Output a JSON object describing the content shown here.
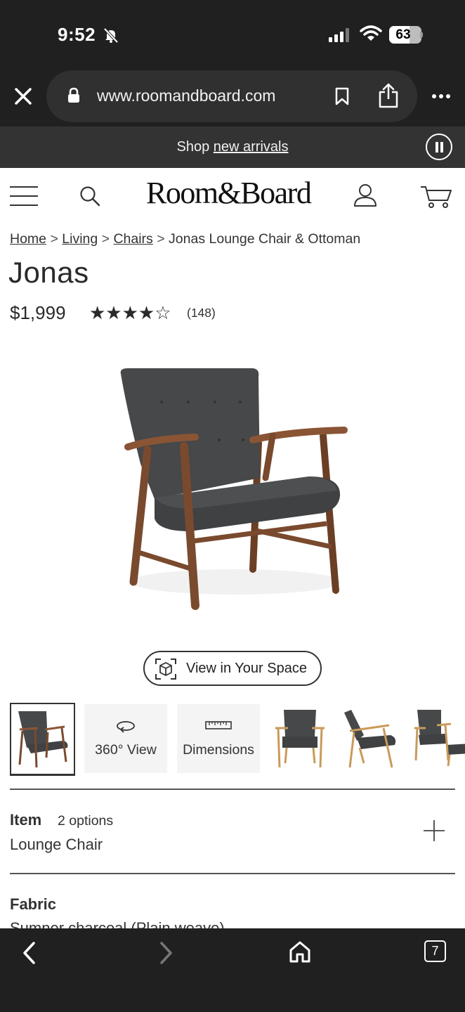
{
  "status_bar": {
    "time": "9:52",
    "battery": "63",
    "battery_level": 0.63
  },
  "browser": {
    "url": "www.roomandboard.com",
    "tab_count": "7"
  },
  "promo": {
    "prefix": "Shop ",
    "link": "new arrivals"
  },
  "header": {
    "logo": "Room&Board"
  },
  "breadcrumb": {
    "items": [
      "Home",
      "Living",
      "Chairs"
    ],
    "current": "Jonas Lounge Chair & Ottoman",
    "separator": ">"
  },
  "product": {
    "title": "Jonas",
    "price": "$1,999",
    "rating": 4.5,
    "stars": "★★★★☆",
    "review_count": "(148)",
    "ar_button": "View in Your Space",
    "colors": {
      "fabric": "#46484a",
      "wood": "#7a4a2e",
      "light_wood": "#c99a5a"
    }
  },
  "thumbnails": {
    "view360": "360° View",
    "dimensions": "Dimensions"
  },
  "options": {
    "item_title": "Item",
    "item_count": "2 options",
    "item_value": "Lounge Chair",
    "fabric_title": "Fabric",
    "fabric_value": "Sumner charcoal (Plain weave)"
  }
}
